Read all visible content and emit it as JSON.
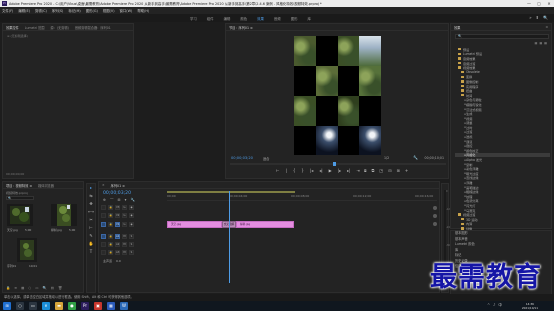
{
  "app": {
    "icon_label": "Pr",
    "title": "Adobe Premiere Pro 2020 - C:\\用户\\Vbus\\桌面\\最需教育\\Adobe Premiere Pro 2020 从新手到高手\\最需教育\\Adobe Premiere Pro 2020 从新手到高手\\第2章\\2.4.6 案例 - 风格化特效\\视频特效.prproj *",
    "controls": [
      "—",
      "▢",
      "✕"
    ]
  },
  "menu": [
    "文件(F)",
    "编辑(E)",
    "剪辑(C)",
    "序列(S)",
    "标记(M)",
    "图形(G)",
    "视图(V)",
    "窗口(W)",
    "帮助(H)"
  ],
  "workspaces": {
    "tabs": [
      "学习",
      "组件",
      "编辑",
      "颜色",
      "效果",
      "音频",
      "图形",
      "库"
    ],
    "active": "效果",
    "right_icons": [
      "»",
      "⬆",
      "🔍"
    ]
  },
  "source_panel": {
    "tabs": [
      "效果控件",
      "Lumetri 范围",
      "源：(无剪辑)",
      "音频剪辑混合器：序列01"
    ],
    "menu": "≡ (无剪辑选择)",
    "timecode": "00;00;00;00"
  },
  "program_panel": {
    "tab": "节目：序列01 ≡",
    "timecode": "00;00;03;20",
    "fit": "适合",
    "fraction": "1/2",
    "duration": "00;00;10;01",
    "transport": [
      "⊢",
      "|",
      "{",
      "}",
      "|◂",
      "◂|",
      "▶",
      "|▸",
      "▸|",
      "⇥"
    ],
    "transport_right": [
      "⧈",
      "⧉",
      "◳",
      "⊟",
      "⊞",
      "+"
    ]
  },
  "effects_panel": {
    "title": "效果",
    "menu_icon": "≡",
    "search_placeholder": "🔍",
    "icons": [
      "▦",
      "▦",
      "▦"
    ],
    "items": [
      {
        "label": "预设",
        "indent": 1,
        "folder": true
      },
      {
        "label": "Lumetri 预设",
        "indent": 1,
        "folder": true
      },
      {
        "label": "音频效果",
        "indent": 1,
        "folder": true
      },
      {
        "label": "音频过渡",
        "indent": 1,
        "folder": true
      },
      {
        "label": "视频效果",
        "indent": 1,
        "folder": true
      },
      {
        "label": "Obsolete",
        "indent": 2,
        "folder": true
      },
      {
        "label": "变换",
        "indent": 2,
        "folder": true
      },
      {
        "label": "图像控制",
        "indent": 2,
        "folder": true
      },
      {
        "label": "实用程序",
        "indent": 2,
        "folder": true
      },
      {
        "label": "扭曲",
        "indent": 2,
        "folder": true
      },
      {
        "label": "时间",
        "indent": 2,
        "folder": true
      },
      {
        "label": "杂色与颗粒",
        "indent": 3,
        "folder": false
      },
      {
        "label": "模糊与锐化",
        "indent": 3,
        "folder": false
      },
      {
        "label": "沉浸式视频",
        "indent": 3,
        "folder": false
      },
      {
        "label": "生成",
        "indent": 3,
        "folder": false
      },
      {
        "label": "视频",
        "indent": 3,
        "folder": false
      },
      {
        "label": "调整",
        "indent": 3,
        "folder": false
      },
      {
        "label": "过时",
        "indent": 3,
        "folder": false
      },
      {
        "label": "过渡",
        "indent": 3,
        "folder": false
      },
      {
        "label": "透视",
        "indent": 3,
        "folder": false
      },
      {
        "label": "通道",
        "indent": 3,
        "folder": false
      },
      {
        "label": "键控",
        "indent": 3,
        "folder": false
      },
      {
        "label": "颜色校正",
        "indent": 3,
        "folder": false
      },
      {
        "label": "风格化",
        "indent": 3,
        "folder": false
      },
      {
        "label": "Alpha 发光",
        "indent": 3,
        "folder": false
      },
      {
        "label": "复制",
        "indent": 3,
        "folder": false
      },
      {
        "label": "彩色浮雕",
        "indent": 3,
        "folder": false
      },
      {
        "label": "曝光过度",
        "indent": 3,
        "folder": false
      },
      {
        "label": "查找边缘",
        "indent": 3,
        "folder": false
      },
      {
        "label": "浮雕",
        "indent": 3,
        "folder": false
      },
      {
        "label": "画笔描边",
        "indent": 3,
        "folder": false
      },
      {
        "label": "粗糙边缘",
        "indent": 3,
        "folder": false
      },
      {
        "label": "纹理",
        "indent": 3,
        "folder": false
      },
      {
        "label": "色调分离",
        "indent": 3,
        "folder": false
      },
      {
        "label": "闪光灯",
        "indent": 3,
        "folder": false
      },
      {
        "label": "马赛克",
        "indent": 3,
        "folder": false
      },
      {
        "label": "视频过渡",
        "indent": 1,
        "folder": true
      },
      {
        "label": "3D 运动",
        "indent": 2,
        "folder": true
      },
      {
        "label": "内滑",
        "indent": 2,
        "folder": true
      },
      {
        "label": "划像",
        "indent": 2,
        "folder": true
      }
    ],
    "selected_index": 23
  },
  "bottom_panel": {
    "items": [
      "基本图形",
      "基本声音",
      "Lumetri 颜色",
      "库",
      "标记",
      "历史记录",
      "信息"
    ]
  },
  "project_panel": {
    "tabs": [
      "项目：视频特效 ≡",
      "媒体浏览器"
    ],
    "subtitle": "视频特效.prproj",
    "search_placeholder": "🔍",
    "thumbs": [
      {
        "label": "天空.jpg",
        "duration": "5;00"
      },
      {
        "label": "绿树.jpg",
        "duration": "5;00"
      },
      {
        "label": "序列01",
        "duration": "10;01"
      }
    ],
    "footer": [
      "🔒",
      "≡",
      "▦",
      "○",
      "▭",
      "🔍",
      "▤",
      "🗑"
    ]
  },
  "tools": [
    "▸",
    "⇆",
    "✥",
    "⟷",
    "✂",
    "⊢",
    "✎",
    "✋",
    "T"
  ],
  "timeline": {
    "tab": "序列01 ≡",
    "timecode": "00;00;03;20",
    "icons": [
      "⊕",
      "⌒",
      "⊞",
      "▾",
      "🔧"
    ],
    "ruler": [
      "00;00",
      "00;00;04;00",
      "00;00;08;00",
      "00;00;12;00",
      "00;00;16;00"
    ],
    "tracks": [
      {
        "name": "V3",
        "label": "V3"
      },
      {
        "name": "V2",
        "label": "V2"
      },
      {
        "name": "V1",
        "label": "V1"
      },
      {
        "name": "A1",
        "label": "A1"
      },
      {
        "name": "A2",
        "label": "A2"
      },
      {
        "name": "A3",
        "label": "A3"
      },
      {
        "name": "主声道",
        "label": "主声道",
        "value": "0.0"
      }
    ],
    "clips": [
      {
        "label": "天空.jpg"
      },
      {
        "label": "交叉溶解"
      },
      {
        "label": "绿树.jpg"
      }
    ]
  },
  "meter": {
    "labels": [
      "0",
      "-12",
      "-24",
      "-36",
      "-48",
      "dB"
    ]
  },
  "status": "单击以选择，或单击空白区域并拖动以进行框选。使用 Shift、Alt 和 Ctrl 可获得其他选项。",
  "taskbar": {
    "icons": [
      {
        "name": "start",
        "glyph": "⊞",
        "color": "#1f6fd1"
      },
      {
        "name": "search",
        "glyph": "○",
        "color": "#2b3540"
      },
      {
        "name": "task-view",
        "glyph": "▭",
        "color": "#2b3540"
      },
      {
        "name": "edge",
        "glyph": "e",
        "color": "#1b8fd9"
      },
      {
        "name": "folder",
        "glyph": "▬",
        "color": "#d6a53a"
      },
      {
        "name": "chrome",
        "glyph": "●",
        "color": "#2f9e44"
      },
      {
        "name": "premiere",
        "glyph": "Pr",
        "color": "#2c1d5c"
      },
      {
        "name": "app-red",
        "glyph": "▣",
        "color": "#c8372d"
      },
      {
        "name": "app-blue",
        "glyph": "▦",
        "color": "#2a5ab8"
      },
      {
        "name": "app-green",
        "glyph": "W",
        "color": "#2b6ab8"
      }
    ],
    "tray": [
      "^",
      "♪",
      "中"
    ],
    "time": "14:36",
    "date": "2021/10/11"
  },
  "watermark": "最需教育"
}
